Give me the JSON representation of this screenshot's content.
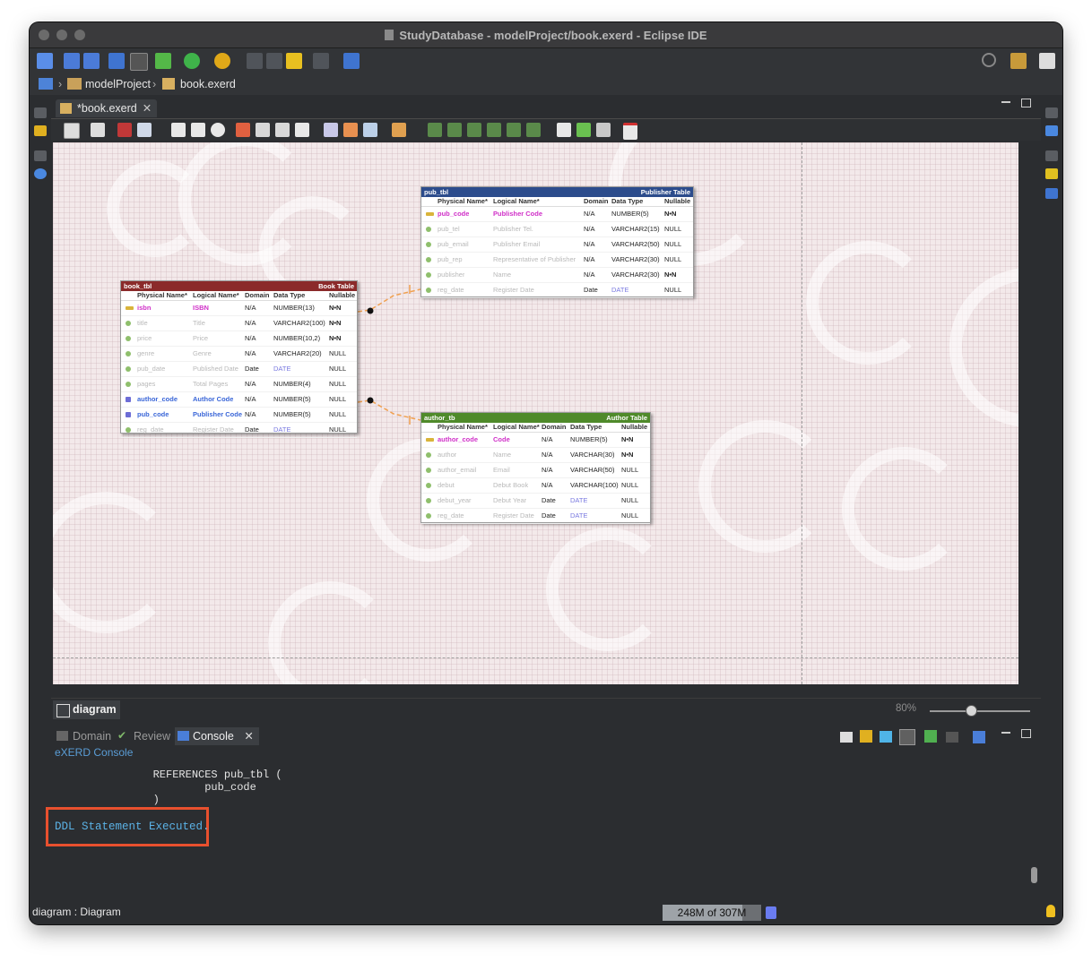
{
  "window": {
    "title": "StudyDatabase - modelProject/book.exerd - Eclipse IDE"
  },
  "breadcrumb": {
    "project": "modelProject",
    "file": "book.exerd"
  },
  "editor": {
    "tab_label": "*book.exerd",
    "close_glyph": "✕"
  },
  "tables": {
    "columns": {
      "physical": "Physical Name*",
      "logical": "Logical Name*",
      "domain": "Domain",
      "type": "Data Type",
      "nullable": "Nullable"
    },
    "book": {
      "name": "book_tbl",
      "logical_title": "Book Table",
      "header_color": "#8b2a2a",
      "rows": [
        {
          "phys": "isbn",
          "log": "ISBN",
          "dom": "N/A",
          "type": "NUMBER(13)",
          "null": "N•N",
          "kind": "pk"
        },
        {
          "phys": "title",
          "log": "Title",
          "dom": "N/A",
          "type": "VARCHAR2(100)",
          "null": "N•N",
          "kind": "col"
        },
        {
          "phys": "price",
          "log": "Price",
          "dom": "N/A",
          "type": "NUMBER(10,2)",
          "null": "N•N",
          "kind": "col"
        },
        {
          "phys": "genre",
          "log": "Genre",
          "dom": "N/A",
          "type": "VARCHAR2(20)",
          "null": "NULL",
          "kind": "col"
        },
        {
          "phys": "pub_date",
          "log": "Published Date",
          "dom": "Date",
          "type": "DATE",
          "null": "NULL",
          "kind": "col"
        },
        {
          "phys": "pages",
          "log": "Total Pages",
          "dom": "N/A",
          "type": "NUMBER(4)",
          "null": "NULL",
          "kind": "col"
        },
        {
          "phys": "author_code",
          "log": "Author Code",
          "dom": "N/A",
          "type": "NUMBER(5)",
          "null": "NULL",
          "kind": "fk"
        },
        {
          "phys": "pub_code",
          "log": "Publisher Code",
          "dom": "N/A",
          "type": "NUMBER(5)",
          "null": "NULL",
          "kind": "fk"
        },
        {
          "phys": "reg_date",
          "log": "Register Date",
          "dom": "Date",
          "type": "DATE",
          "null": "NULL",
          "kind": "col"
        }
      ]
    },
    "pub": {
      "name": "pub_tbl",
      "logical_title": "Publisher Table",
      "header_color": "#2c4c8c",
      "rows": [
        {
          "phys": "pub_code",
          "log": "Publisher Code",
          "dom": "N/A",
          "type": "NUMBER(5)",
          "null": "N•N",
          "kind": "pk"
        },
        {
          "phys": "pub_tel",
          "log": "Publisher Tel.",
          "dom": "N/A",
          "type": "VARCHAR2(15)",
          "null": "NULL",
          "kind": "col"
        },
        {
          "phys": "pub_email",
          "log": "Publisher Email",
          "dom": "N/A",
          "type": "VARCHAR2(50)",
          "null": "NULL",
          "kind": "col"
        },
        {
          "phys": "pub_rep",
          "log": "Representative of Publisher",
          "dom": "N/A",
          "type": "VARCHAR2(30)",
          "null": "NULL",
          "kind": "col"
        },
        {
          "phys": "publisher",
          "log": "Name",
          "dom": "N/A",
          "type": "VARCHAR2(30)",
          "null": "N•N",
          "kind": "col"
        },
        {
          "phys": "reg_date",
          "log": "Register Date",
          "dom": "Date",
          "type": "DATE",
          "null": "NULL",
          "kind": "col"
        }
      ]
    },
    "author": {
      "name": "author_tb",
      "logical_title": "Author Table",
      "header_color": "#4f8a2a",
      "rows": [
        {
          "phys": "author_code",
          "log": "Code",
          "dom": "N/A",
          "type": "NUMBER(5)",
          "null": "N•N",
          "kind": "pk"
        },
        {
          "phys": "author",
          "log": "Name",
          "dom": "N/A",
          "type": "VARCHAR(30)",
          "null": "N•N",
          "kind": "col"
        },
        {
          "phys": "author_email",
          "log": "Email",
          "dom": "N/A",
          "type": "VARCHAR(50)",
          "null": "NULL",
          "kind": "col"
        },
        {
          "phys": "debut",
          "log": "Debut Book",
          "dom": "N/A",
          "type": "VARCHAR(100)",
          "null": "NULL",
          "kind": "col"
        },
        {
          "phys": "debut_year",
          "log": "Debut Year",
          "dom": "Date",
          "type": "DATE",
          "null": "NULL",
          "kind": "col"
        },
        {
          "phys": "reg_date",
          "log": "Register Date",
          "dom": "Date",
          "type": "DATE",
          "null": "NULL",
          "kind": "col"
        }
      ]
    }
  },
  "diagram_tab": {
    "label": "diagram",
    "zoom": "80%",
    "zoom_fraction": 0.4
  },
  "panel": {
    "tabs": [
      {
        "label": "Domain"
      },
      {
        "label": "Review"
      },
      {
        "label": "Console"
      }
    ],
    "console_label": "eXERD Console",
    "lines": [
      "        REFERENCES pub_tbl (",
      "                pub_code",
      "        )"
    ],
    "ddl_message": "DDL Statement Executed."
  },
  "status": {
    "text": "diagram : Diagram",
    "heap": "248M of 307M",
    "heap_fraction": 0.81
  },
  "colors": {
    "accent": "#e8502e",
    "console_blue": "#5bb2e6",
    "relation": "#f0a050"
  }
}
